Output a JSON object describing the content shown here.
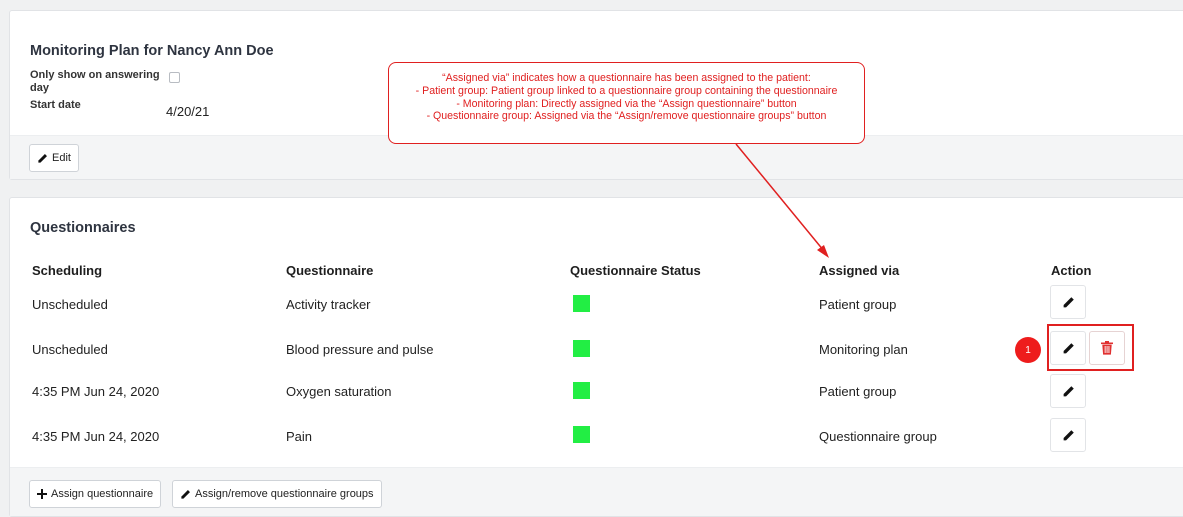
{
  "plan": {
    "title": "Monitoring Plan for Nancy Ann Doe",
    "only_show_label": "Only show on answering day",
    "start_date_label": "Start date",
    "start_date_value": "4/20/21",
    "only_show_checked": false,
    "edit_button": "Edit"
  },
  "callout": {
    "lines": [
      "“Assigned via” indicates how a questionnaire has been assigned to the patient:",
      "- Patient group: Patient group linked to a questionnaire group containing the questionnaire",
      "- Monitoring plan: Directly assigned via the “Assign questionnaire” button",
      "- Questionnaire group: Assigned via the “Assign/remove questionnaire groups” button"
    ]
  },
  "questionnaires": {
    "title": "Questionnaires",
    "headers": {
      "scheduling": "Scheduling",
      "questionnaire": "Questionnaire",
      "status": "Questionnaire Status",
      "assigned_via": "Assigned via",
      "action": "Action"
    },
    "rows": [
      {
        "scheduling": "Unscheduled",
        "questionnaire": "Activity tracker",
        "status_color": "#22ee44",
        "assigned_via": "Patient group"
      },
      {
        "scheduling": "Unscheduled",
        "questionnaire": "Blood pressure and pulse",
        "status_color": "#22ee44",
        "assigned_via": "Monitoring plan"
      },
      {
        "scheduling": "4:35 PM Jun 24, 2020",
        "questionnaire": "Oxygen saturation",
        "status_color": "#22ee44",
        "assigned_via": "Patient group"
      },
      {
        "scheduling": "4:35 PM Jun 24, 2020",
        "questionnaire": "Pain",
        "status_color": "#22ee44",
        "assigned_via": "Questionnaire group"
      }
    ],
    "badge": "1",
    "assign_button": "Assign questionnaire",
    "assign_groups_button": "Assign/remove questionnaire groups"
  },
  "icons": {
    "edit": "pencil-icon",
    "delete": "trash-icon",
    "add": "plus-icon"
  },
  "colors": {
    "annotation_red": "#e02020",
    "status_green": "#22ee44",
    "delete_red": "#e03030"
  }
}
